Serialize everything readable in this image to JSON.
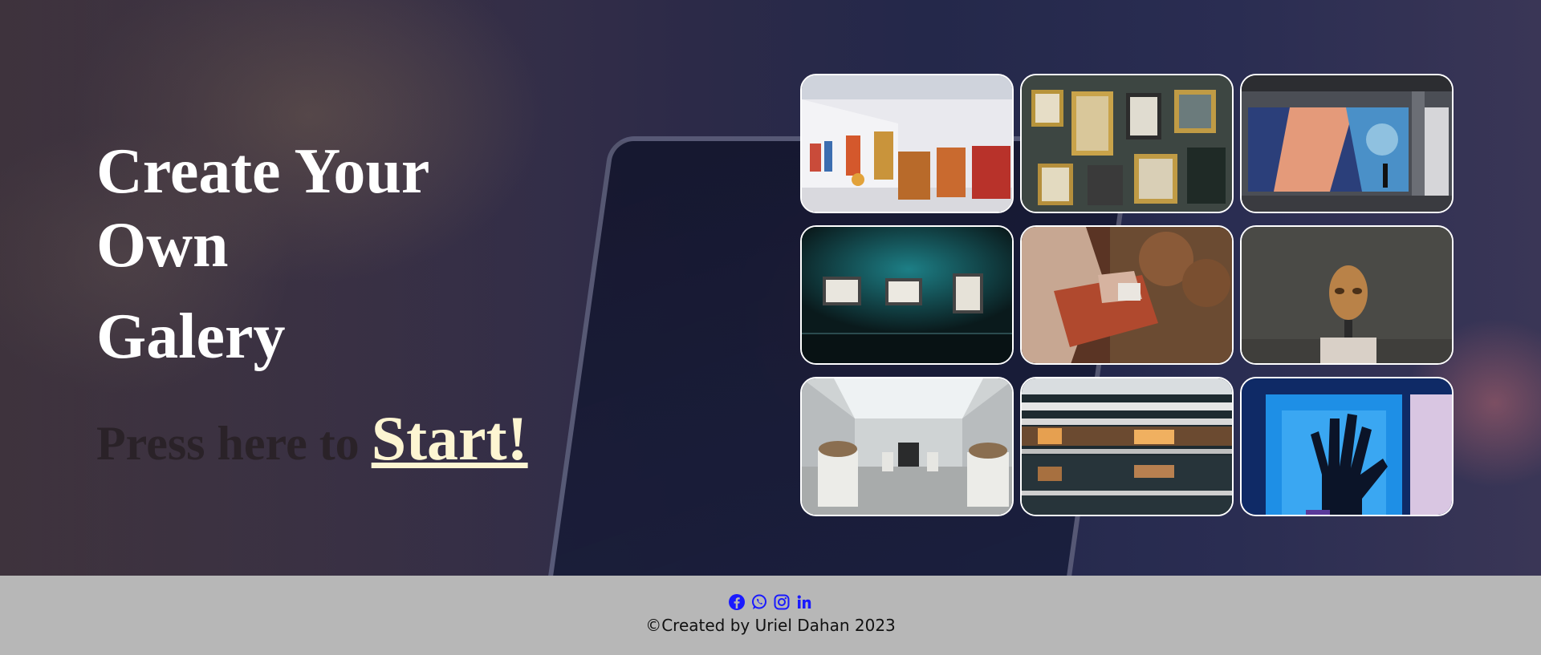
{
  "hero": {
    "title_line1": "Create Your",
    "title_line2": "Own",
    "title_line3": "Galery",
    "press_text": "Press here to",
    "start_link": "Start!"
  },
  "gallery": {
    "tiles": [
      {
        "name": "white-gallery-hall-photo"
      },
      {
        "name": "framed-artworks-wall-photo"
      },
      {
        "name": "mural-exhibition-photo"
      },
      {
        "name": "teal-lit-frames-photo"
      },
      {
        "name": "artist-hands-painting-photo"
      },
      {
        "name": "sculpture-head-photo"
      },
      {
        "name": "museum-sculpture-hall-photo"
      },
      {
        "name": "mall-atrium-reflection-photo"
      },
      {
        "name": "blue-hand-art-photo"
      }
    ]
  },
  "footer": {
    "social_icons": [
      "facebook-icon",
      "whatsapp-icon",
      "instagram-icon",
      "linkedin-icon"
    ],
    "icon_color": "#1a1aff",
    "credit": "©Created by Uriel Dahan 2023"
  }
}
